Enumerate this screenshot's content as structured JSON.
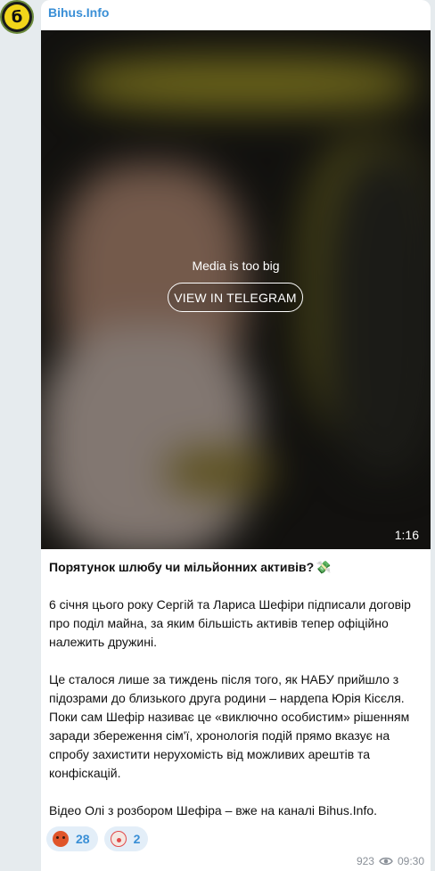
{
  "channel": {
    "name": "Bihus.Info",
    "avatar_letter": "б"
  },
  "media": {
    "message": "Media is too big",
    "button_label": "VIEW IN TELEGRAM",
    "duration": "1:16"
  },
  "post": {
    "title": "Порятунок шлюбу чи мільйонних активів?",
    "title_icon": "money-with-wings-icon",
    "paragraphs": [
      "6 січня цього року Сергій та Лариса Шефіри підписали договір про поділ майна, за яким більшість активів тепер офіційно належить дружині.",
      "Це сталося лише за тиждень після того, як НАБУ прийшло з підозрами до близького друга родини – нардепа Юрія Кісєля. Поки сам Шефір називає це «виключно особистим» рішенням заради збереження сім'ї, хронологія подій прямо вказує на спробу захистити нерухомість від можливих арештів та конфіскацій.",
      "Відео Олі з розбором Шефіра – вже на каналі Bihus.Info."
    ]
  },
  "reactions": [
    {
      "icon": "angry-face-icon",
      "count": "28"
    },
    {
      "icon": "clown-face-icon",
      "count": "2"
    }
  ],
  "meta": {
    "views": "923",
    "time": "09:30"
  },
  "colors": {
    "accent": "#3a8fd6",
    "background": "#e6ebee",
    "reaction_bg": "#e3eef8"
  }
}
